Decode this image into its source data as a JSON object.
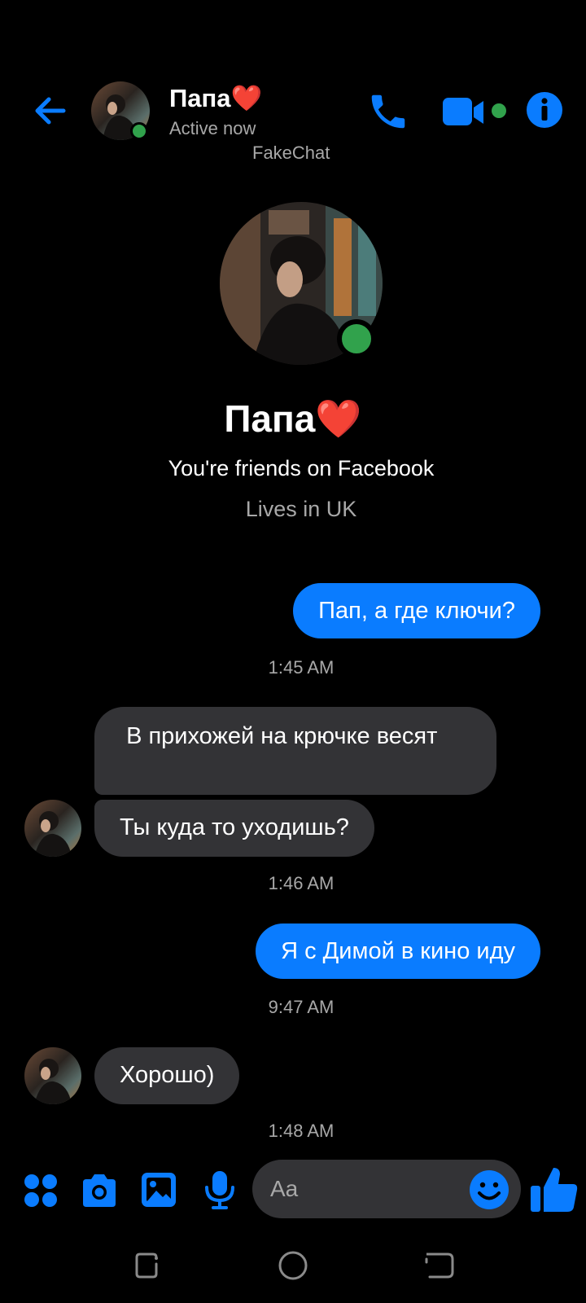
{
  "header": {
    "contact_name": "Папа❤️",
    "status": "Active now",
    "watermark": "FakeChat"
  },
  "profile": {
    "name": "Папа❤️",
    "friends_text": "You're friends on Facebook",
    "lives_text": "Lives in UK"
  },
  "messages": [
    {
      "direction": "outgoing",
      "text": "Пап, а где ключи?"
    },
    {
      "timestamp": "1:45 AM"
    },
    {
      "direction": "incoming",
      "text": " В прихожей на крючке весят"
    },
    {
      "direction": "incoming",
      "text": "Ты куда то уходишь?"
    },
    {
      "timestamp": "1:46 AM"
    },
    {
      "direction": "outgoing",
      "text": "Я с Димой в кино иду"
    },
    {
      "timestamp": "9:47 AM"
    },
    {
      "direction": "incoming",
      "text": "Хорошо)"
    },
    {
      "timestamp": "1:48 AM"
    }
  ],
  "composer": {
    "placeholder": "Aa"
  },
  "colors": {
    "accent": "#0a7cff",
    "online": "#31a24c",
    "incoming_bubble": "#333336",
    "background": "#000000"
  },
  "icons": [
    "back-arrow-icon",
    "phone-icon",
    "video-camera-icon",
    "info-icon",
    "apps-icon",
    "camera-icon",
    "gallery-icon",
    "microphone-icon",
    "emoji-icon",
    "thumbs-up-icon",
    "recent-apps-icon",
    "home-icon",
    "back-icon"
  ]
}
